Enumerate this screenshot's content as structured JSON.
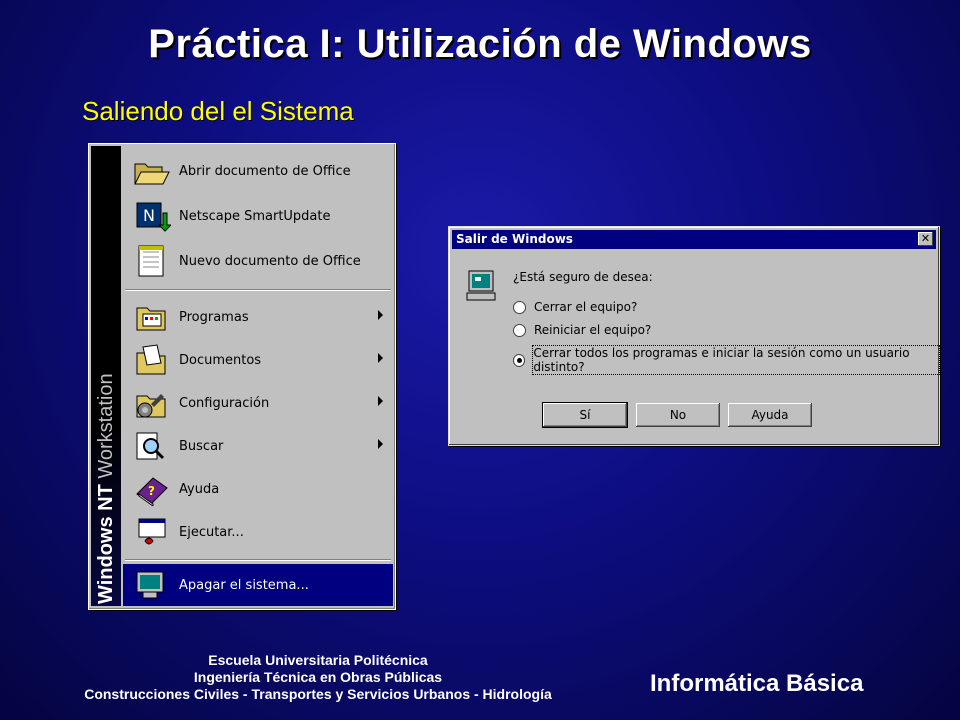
{
  "slide": {
    "title": "Práctica I: Utilización de Windows",
    "subtitle": "Saliendo del el Sistema"
  },
  "start_menu": {
    "band_text_bold": "Windows NT",
    "band_text_light": " Workstation",
    "items": [
      {
        "label": "Abrir documento de Office",
        "icon": "folder-open-icon",
        "submenu": false
      },
      {
        "label": "Netscape SmartUpdate",
        "icon": "netscape-update-icon",
        "submenu": false
      },
      {
        "label": "Nuevo documento de Office",
        "icon": "new-document-icon",
        "submenu": false
      },
      {
        "label": "Programas",
        "icon": "programs-icon",
        "submenu": true
      },
      {
        "label": "Documentos",
        "icon": "documents-icon",
        "submenu": true
      },
      {
        "label": "Configuración",
        "icon": "settings-icon",
        "submenu": true
      },
      {
        "label": "Buscar",
        "icon": "search-icon",
        "submenu": true
      },
      {
        "label": "Ayuda",
        "icon": "help-book-icon",
        "submenu": false
      },
      {
        "label": "Ejecutar...",
        "icon": "run-icon",
        "submenu": false
      },
      {
        "label": "Apagar el sistema...",
        "icon": "shutdown-icon",
        "submenu": false,
        "highlighted": true
      }
    ]
  },
  "dialog": {
    "title": "Salir de Windows",
    "close_glyph": "✕",
    "question": "¿Está seguro de desea:",
    "options": [
      {
        "label": "Cerrar el equipo?",
        "selected": false
      },
      {
        "label": "Reiniciar el equipo?",
        "selected": false
      },
      {
        "label": "Cerrar todos los programas e iniciar la sesión como un usuario distinto?",
        "selected": true
      }
    ],
    "buttons": {
      "yes": "Sí",
      "no": "No",
      "help": "Ayuda"
    }
  },
  "footer": {
    "line1": "Escuela Universitaria Politécnica",
    "line2": "Ingeniería Técnica en Obras Públicas",
    "line3": "Construcciones Civiles - Transportes y Servicios Urbanos - Hidrología",
    "course": "Informática Básica"
  }
}
